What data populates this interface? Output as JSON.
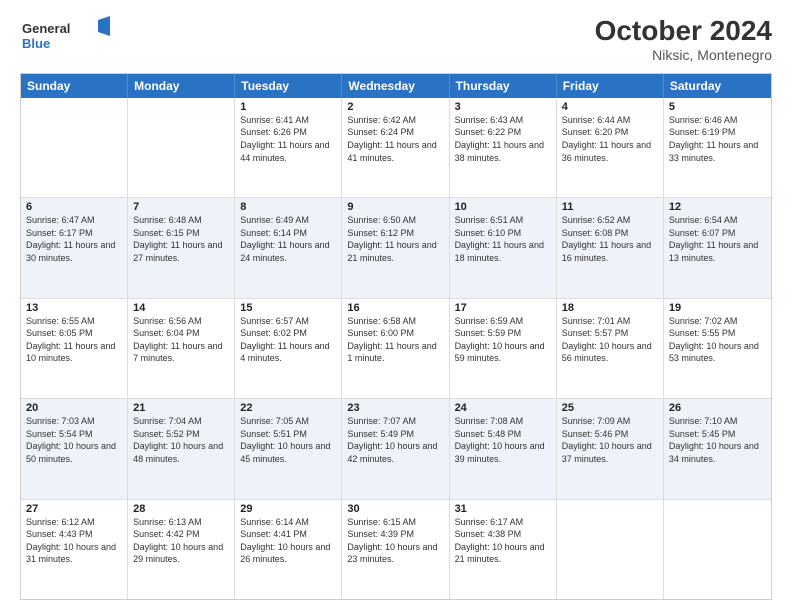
{
  "header": {
    "logo": {
      "line1": "General",
      "line2": "Blue"
    },
    "title": "October 2024",
    "subtitle": "Niksic, Montenegro"
  },
  "days": [
    "Sunday",
    "Monday",
    "Tuesday",
    "Wednesday",
    "Thursday",
    "Friday",
    "Saturday"
  ],
  "weeks": [
    [
      {
        "date": "",
        "sunrise": "",
        "sunset": "",
        "daylight": ""
      },
      {
        "date": "",
        "sunrise": "",
        "sunset": "",
        "daylight": ""
      },
      {
        "date": "1",
        "sunrise": "Sunrise: 6:41 AM",
        "sunset": "Sunset: 6:26 PM",
        "daylight": "Daylight: 11 hours and 44 minutes."
      },
      {
        "date": "2",
        "sunrise": "Sunrise: 6:42 AM",
        "sunset": "Sunset: 6:24 PM",
        "daylight": "Daylight: 11 hours and 41 minutes."
      },
      {
        "date": "3",
        "sunrise": "Sunrise: 6:43 AM",
        "sunset": "Sunset: 6:22 PM",
        "daylight": "Daylight: 11 hours and 38 minutes."
      },
      {
        "date": "4",
        "sunrise": "Sunrise: 6:44 AM",
        "sunset": "Sunset: 6:20 PM",
        "daylight": "Daylight: 11 hours and 36 minutes."
      },
      {
        "date": "5",
        "sunrise": "Sunrise: 6:46 AM",
        "sunset": "Sunset: 6:19 PM",
        "daylight": "Daylight: 11 hours and 33 minutes."
      }
    ],
    [
      {
        "date": "6",
        "sunrise": "Sunrise: 6:47 AM",
        "sunset": "Sunset: 6:17 PM",
        "daylight": "Daylight: 11 hours and 30 minutes."
      },
      {
        "date": "7",
        "sunrise": "Sunrise: 6:48 AM",
        "sunset": "Sunset: 6:15 PM",
        "daylight": "Daylight: 11 hours and 27 minutes."
      },
      {
        "date": "8",
        "sunrise": "Sunrise: 6:49 AM",
        "sunset": "Sunset: 6:14 PM",
        "daylight": "Daylight: 11 hours and 24 minutes."
      },
      {
        "date": "9",
        "sunrise": "Sunrise: 6:50 AM",
        "sunset": "Sunset: 6:12 PM",
        "daylight": "Daylight: 11 hours and 21 minutes."
      },
      {
        "date": "10",
        "sunrise": "Sunrise: 6:51 AM",
        "sunset": "Sunset: 6:10 PM",
        "daylight": "Daylight: 11 hours and 18 minutes."
      },
      {
        "date": "11",
        "sunrise": "Sunrise: 6:52 AM",
        "sunset": "Sunset: 6:08 PM",
        "daylight": "Daylight: 11 hours and 16 minutes."
      },
      {
        "date": "12",
        "sunrise": "Sunrise: 6:54 AM",
        "sunset": "Sunset: 6:07 PM",
        "daylight": "Daylight: 11 hours and 13 minutes."
      }
    ],
    [
      {
        "date": "13",
        "sunrise": "Sunrise: 6:55 AM",
        "sunset": "Sunset: 6:05 PM",
        "daylight": "Daylight: 11 hours and 10 minutes."
      },
      {
        "date": "14",
        "sunrise": "Sunrise: 6:56 AM",
        "sunset": "Sunset: 6:04 PM",
        "daylight": "Daylight: 11 hours and 7 minutes."
      },
      {
        "date": "15",
        "sunrise": "Sunrise: 6:57 AM",
        "sunset": "Sunset: 6:02 PM",
        "daylight": "Daylight: 11 hours and 4 minutes."
      },
      {
        "date": "16",
        "sunrise": "Sunrise: 6:58 AM",
        "sunset": "Sunset: 6:00 PM",
        "daylight": "Daylight: 11 hours and 1 minute."
      },
      {
        "date": "17",
        "sunrise": "Sunrise: 6:59 AM",
        "sunset": "Sunset: 5:59 PM",
        "daylight": "Daylight: 10 hours and 59 minutes."
      },
      {
        "date": "18",
        "sunrise": "Sunrise: 7:01 AM",
        "sunset": "Sunset: 5:57 PM",
        "daylight": "Daylight: 10 hours and 56 minutes."
      },
      {
        "date": "19",
        "sunrise": "Sunrise: 7:02 AM",
        "sunset": "Sunset: 5:55 PM",
        "daylight": "Daylight: 10 hours and 53 minutes."
      }
    ],
    [
      {
        "date": "20",
        "sunrise": "Sunrise: 7:03 AM",
        "sunset": "Sunset: 5:54 PM",
        "daylight": "Daylight: 10 hours and 50 minutes."
      },
      {
        "date": "21",
        "sunrise": "Sunrise: 7:04 AM",
        "sunset": "Sunset: 5:52 PM",
        "daylight": "Daylight: 10 hours and 48 minutes."
      },
      {
        "date": "22",
        "sunrise": "Sunrise: 7:05 AM",
        "sunset": "Sunset: 5:51 PM",
        "daylight": "Daylight: 10 hours and 45 minutes."
      },
      {
        "date": "23",
        "sunrise": "Sunrise: 7:07 AM",
        "sunset": "Sunset: 5:49 PM",
        "daylight": "Daylight: 10 hours and 42 minutes."
      },
      {
        "date": "24",
        "sunrise": "Sunrise: 7:08 AM",
        "sunset": "Sunset: 5:48 PM",
        "daylight": "Daylight: 10 hours and 39 minutes."
      },
      {
        "date": "25",
        "sunrise": "Sunrise: 7:09 AM",
        "sunset": "Sunset: 5:46 PM",
        "daylight": "Daylight: 10 hours and 37 minutes."
      },
      {
        "date": "26",
        "sunrise": "Sunrise: 7:10 AM",
        "sunset": "Sunset: 5:45 PM",
        "daylight": "Daylight: 10 hours and 34 minutes."
      }
    ],
    [
      {
        "date": "27",
        "sunrise": "Sunrise: 6:12 AM",
        "sunset": "Sunset: 4:43 PM",
        "daylight": "Daylight: 10 hours and 31 minutes."
      },
      {
        "date": "28",
        "sunrise": "Sunrise: 6:13 AM",
        "sunset": "Sunset: 4:42 PM",
        "daylight": "Daylight: 10 hours and 29 minutes."
      },
      {
        "date": "29",
        "sunrise": "Sunrise: 6:14 AM",
        "sunset": "Sunset: 4:41 PM",
        "daylight": "Daylight: 10 hours and 26 minutes."
      },
      {
        "date": "30",
        "sunrise": "Sunrise: 6:15 AM",
        "sunset": "Sunset: 4:39 PM",
        "daylight": "Daylight: 10 hours and 23 minutes."
      },
      {
        "date": "31",
        "sunrise": "Sunrise: 6:17 AM",
        "sunset": "Sunset: 4:38 PM",
        "daylight": "Daylight: 10 hours and 21 minutes."
      },
      {
        "date": "",
        "sunrise": "",
        "sunset": "",
        "daylight": ""
      },
      {
        "date": "",
        "sunrise": "",
        "sunset": "",
        "daylight": ""
      }
    ]
  ]
}
